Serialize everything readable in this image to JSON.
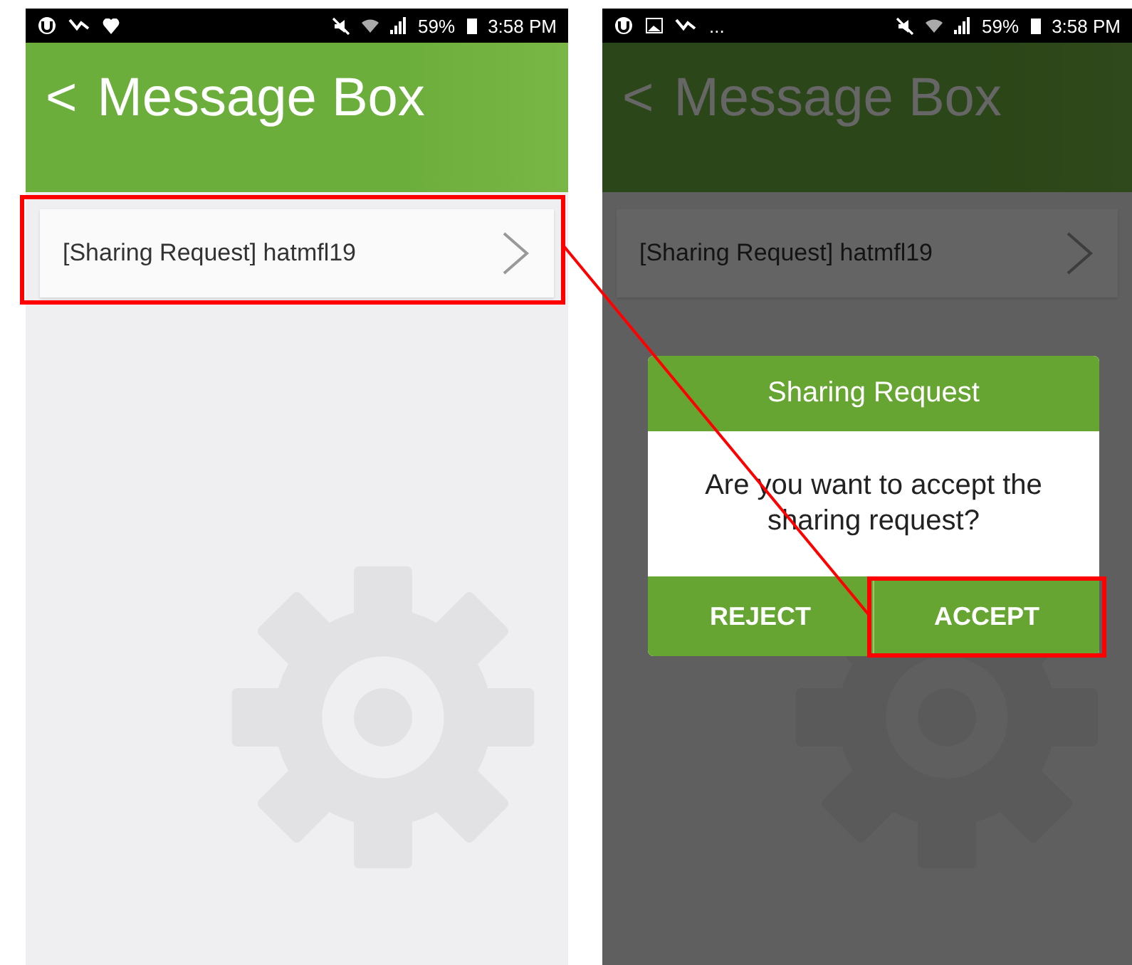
{
  "screens": [
    {
      "dimmed": false,
      "status_bar": {
        "battery": "59%",
        "time": "3:58 PM"
      },
      "header": {
        "back": "<",
        "title": "Message Box"
      },
      "messages": [
        {
          "text": "[Sharing Request] hatmfl19"
        }
      ]
    },
    {
      "dimmed": true,
      "status_bar": {
        "overflow": "...",
        "battery": "59%",
        "time": "3:58 PM"
      },
      "header": {
        "back": "<",
        "title": "Message Box"
      },
      "messages": [
        {
          "text": "[Sharing Request] hatmfl19"
        }
      ],
      "dialog": {
        "title": "Sharing Request",
        "message": "Are you want to accept the sharing request?",
        "buttons": [
          {
            "label": "REJECT"
          },
          {
            "label": "ACCEPT"
          }
        ]
      }
    }
  ]
}
